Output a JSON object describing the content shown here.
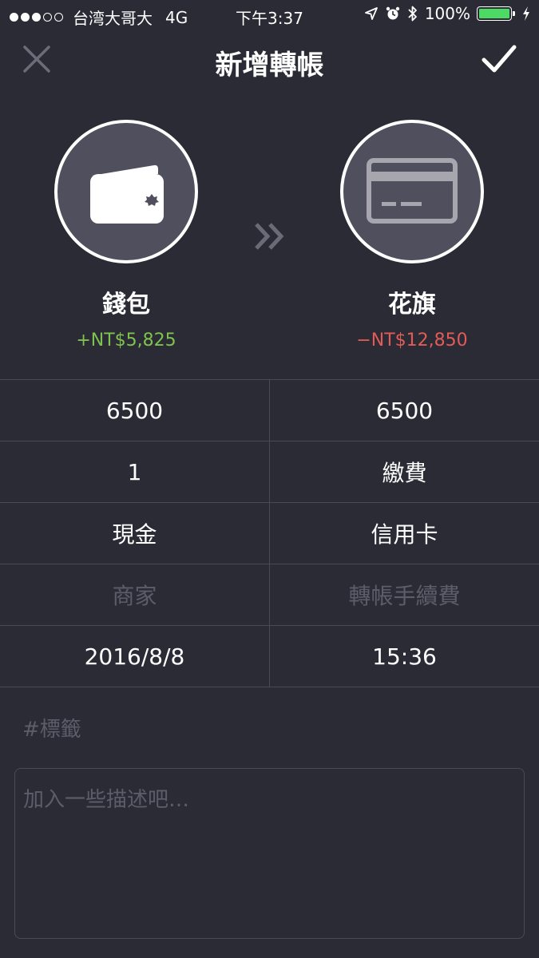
{
  "status_bar": {
    "carrier": "台湾大哥大",
    "network": "4G",
    "time": "下午3:37",
    "battery": "100%",
    "icons": [
      "signal-dots",
      "location-arrow-icon",
      "alarm-icon",
      "bluetooth-icon",
      "battery-icon",
      "charging-bolt-icon"
    ]
  },
  "nav": {
    "title": "新增轉帳",
    "close_icon": "close-icon",
    "confirm_icon": "checkmark-icon"
  },
  "from_account": {
    "name": "錢包",
    "balance": "+NT$5,825",
    "icon": "wallet-icon"
  },
  "to_account": {
    "name": "花旗",
    "balance": "−NT$12,850",
    "icon": "credit-card-icon"
  },
  "transfer_icon": "double-chevron-right-icon",
  "grid": {
    "amount_out": "6500",
    "amount_in": "6500",
    "quantity": "1",
    "category": "繳費",
    "payment_from": "現金",
    "payment_to": "信用卡",
    "merchant_placeholder": "商家",
    "fee_placeholder": "轉帳手續費",
    "date": "2016/8/8",
    "time": "15:36"
  },
  "tags_placeholder": "#標籤",
  "description_placeholder": "加入一些描述吧…",
  "colors": {
    "background": "#2b2b36",
    "circle_fill": "#504f5e",
    "positive": "#7fc24e",
    "negative": "#e25b57",
    "divider": "#4a4a56",
    "placeholder": "#5d5d69",
    "battery": "#4cd964"
  }
}
